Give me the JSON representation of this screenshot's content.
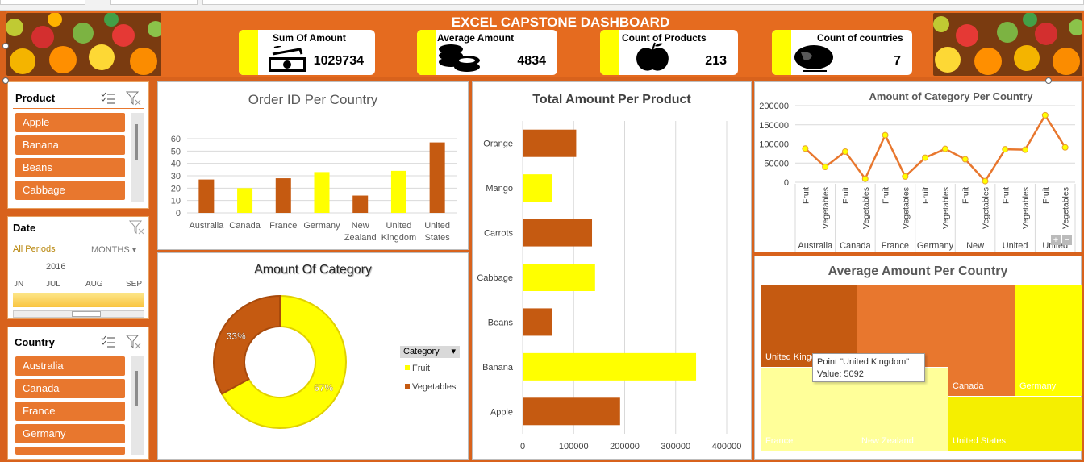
{
  "header": {
    "title": "EXCEL CAPSTONE DASHBOARD",
    "kpis": [
      {
        "label": "Sum Of Amount",
        "value": "1029734",
        "icon": "money-icon"
      },
      {
        "label": "Average Amount",
        "value": "4834",
        "icon": "coins-icon"
      },
      {
        "label": "Count of Products",
        "value": "213",
        "icon": "apple-icon"
      },
      {
        "label": "Count of countries",
        "value": "7",
        "icon": "globe-icon"
      }
    ]
  },
  "colors": {
    "orange": "#e8772e",
    "dark_orange": "#c55a11",
    "yellow": "#ffff00",
    "bg": "#d8621c"
  },
  "slicers": {
    "product": {
      "title": "Product",
      "items": [
        "Apple",
        "Banana",
        "Beans",
        "Cabbage"
      ]
    },
    "date": {
      "title": "Date",
      "all_periods": "All Periods",
      "level": "MONTHS",
      "year": "2016",
      "months": [
        "JN",
        "JUL",
        "AUG",
        "SEP"
      ]
    },
    "country": {
      "title": "Country",
      "items": [
        "Australia",
        "Canada",
        "France",
        "Germany"
      ]
    }
  },
  "charts": {
    "order_id": {
      "title": "Order ID Per Country"
    },
    "total_amount": {
      "title": "Total Amount Per Product"
    },
    "category_country": {
      "title": "Amount of Category Per Country"
    },
    "amount_category": {
      "title": "Amount Of Category",
      "legend_title": "Category"
    },
    "avg_country": {
      "title": "Average Amount Per Country",
      "tooltip_line1": "Point \"United Kingdom\"",
      "tooltip_line2": "Value: 5092"
    }
  },
  "chart_data": [
    {
      "type": "bar",
      "title": "Order ID Per Country",
      "categories": [
        "Australia",
        "Canada",
        "France",
        "Germany",
        "New Zealand",
        "United Kingdom",
        "United States"
      ],
      "values": [
        27,
        20,
        28,
        33,
        14,
        34,
        57
      ],
      "colors": [
        "#c55a11",
        "#ffff00",
        "#c55a11",
        "#ffff00",
        "#c55a11",
        "#ffff00",
        "#c55a11"
      ],
      "ylim": [
        0,
        60
      ],
      "yticks": [
        0,
        10,
        20,
        30,
        40,
        50,
        60
      ],
      "grid": true
    },
    {
      "type": "bar",
      "orientation": "horizontal",
      "title": "Total Amount Per Product",
      "categories": [
        "Orange",
        "Mango",
        "Carrots",
        "Cabbage",
        "Beans",
        "Banana",
        "Apple"
      ],
      "values": [
        105000,
        57000,
        136000,
        142000,
        57000,
        340000,
        191000
      ],
      "colors": [
        "#c55a11",
        "#ffff00",
        "#c55a11",
        "#ffff00",
        "#c55a11",
        "#ffff00",
        "#c55a11"
      ],
      "xlim": [
        0,
        400000
      ],
      "xticks": [
        0,
        100000,
        200000,
        300000,
        400000
      ],
      "grid": true
    },
    {
      "type": "line",
      "title": "Amount of Category Per Country",
      "categories": [
        "Fruit",
        "Vegetables",
        "Fruit",
        "Vegetables",
        "Fruit",
        "Vegetables",
        "Fruit",
        "Vegetables",
        "Fruit",
        "Vegetables",
        "Fruit",
        "Vegetables",
        "Fruit",
        "Vegetables"
      ],
      "groups": [
        "Australia",
        "Canada",
        "France",
        "Germany",
        "New",
        "United",
        "United"
      ],
      "values": [
        88000,
        40000,
        80000,
        9000,
        123000,
        15000,
        64000,
        87000,
        60000,
        3000,
        86000,
        85000,
        175000,
        91000
      ],
      "ylim": [
        0,
        200000
      ],
      "yticks": [
        0,
        50000,
        100000,
        150000,
        200000
      ],
      "grid": true
    },
    {
      "type": "pie",
      "title": "Amount Of Category",
      "labels": [
        "Fruit",
        "Vegetables"
      ],
      "values": [
        67,
        33
      ],
      "colors": [
        "#ffff00",
        "#c55a11"
      ],
      "legend": "right"
    },
    {
      "type": "treemap",
      "title": "Average Amount Per Country",
      "labels": [
        "United Kingdom",
        "",
        "Canada",
        "Germany",
        "France",
        "New Zealand",
        "United States"
      ],
      "colors": [
        "#c55a11",
        "#e8772e",
        "#e8772e",
        "#ffff00",
        "#ffff99",
        "#ffff99",
        "#f5ef00"
      ]
    }
  ]
}
